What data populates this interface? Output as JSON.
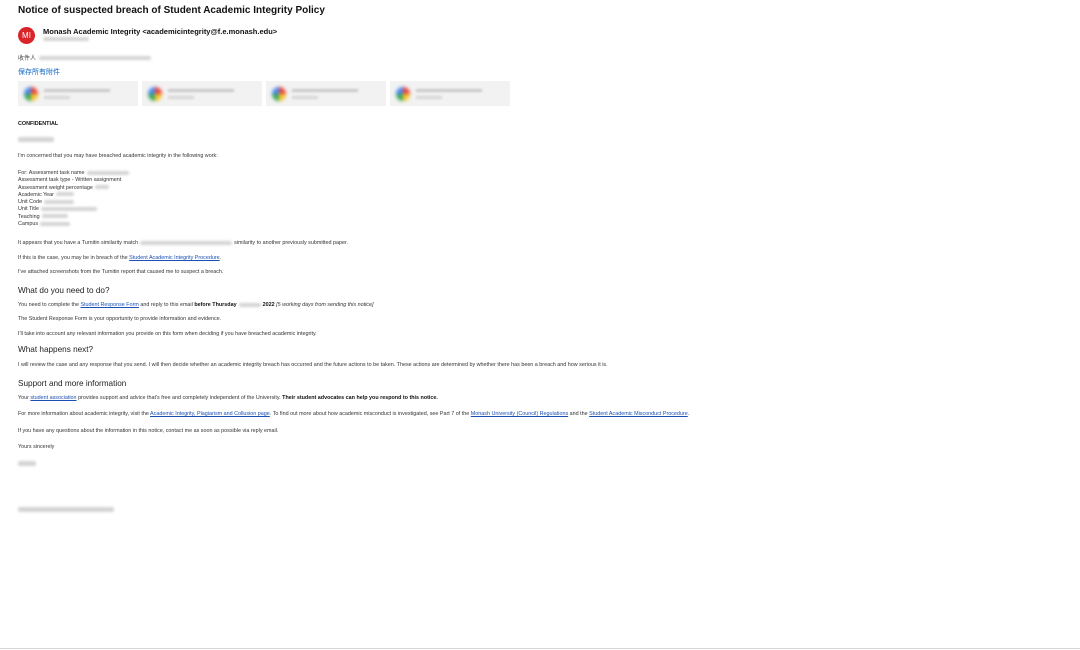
{
  "email": {
    "subject": "Notice of suspected breach of Student Academic Integrity Policy",
    "avatar_initials": "MI",
    "sender": "Monash Academic Integrity <academicintegrity@f.e.monash.edu>",
    "to_label": "收件人",
    "save_attachments": "保存所有附件",
    "attachment_count": 4
  },
  "letter": {
    "confidential": "CONFIDENTIAL",
    "intro": "I'm concerned that you may have breached academic integrity in the following work:",
    "details": [
      "For: Assessment task name",
      "Assessment task type - Written assignment",
      "Assessment weight percentage",
      "Academic Year",
      "Unit Code",
      "Unit Title",
      "Teaching",
      "Campus"
    ],
    "turnitin_a": "It appears that you have a Turnitin similarity match",
    "turnitin_b": "similarity to another previously submitted paper.",
    "breach_a": "If this is the case, you may be in breach of the",
    "breach_link": "Student Academic Integrity Procedure",
    "breach_b": ".",
    "attached": "I've attached screenshots from the Turnitin report that caused me to suspect a breach.",
    "h_what": "What do you need to do?",
    "need_a": "You need to complete the",
    "need_link": "Student Response Form",
    "need_b": "and reply to this email",
    "need_bold_a": "before Thursday",
    "need_bold_b": "2022",
    "need_italic": "[5 working days from sending this notice]",
    "opportunity": "The Student Response Form is your opportunity to provide information and evidence.",
    "account": "I'll take into account any relevant information you provide on this form when deciding if you have breached academic integrity.",
    "h_next": "What happens next?",
    "review": "I will review the case and any response that you send. I will then decide whether an academic integrity breach has occurred and the future actions to be taken. These actions are determined by whether there has been a breach and how serious it is.",
    "h_support": "Support and more information",
    "support_a": "Your",
    "support_link": "student association",
    "support_b": "provides support and advice that's free and completely independent of the University.",
    "support_bold": "Their student advocates can help you respond to this notice.",
    "more_a": "For more information about academic integrity, visit the",
    "more_link1": "Academic Integrity, Plagiarism and Collusion page",
    "more_b": ". To find out more about how academic misconduct is investigated, see Part 7 of the",
    "more_link2": "Monash University (Council) Regulations",
    "more_c": "and the",
    "more_link3": "Student Academic Misconduct Procedure",
    "more_d": ".",
    "questions": "If you have any questions about the information in this notice, contact me as soon as possible via reply email.",
    "signoff": "Yours sincerely"
  }
}
